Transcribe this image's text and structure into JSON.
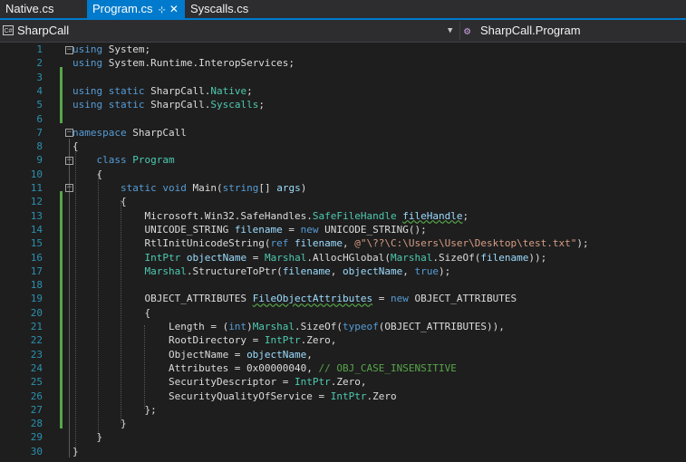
{
  "tabs": [
    {
      "label": "Native.cs",
      "active": false
    },
    {
      "label": "Program.cs",
      "active": true,
      "pin": "⊹",
      "close": "✕"
    },
    {
      "label": "Syscalls.cs",
      "active": false
    }
  ],
  "navbar": {
    "project": "SharpCall",
    "project_icon": "C#",
    "member": "SharpCall.Program"
  },
  "colors": {
    "accent": "#007acc",
    "keyword": "#569cd6",
    "type": "#4ec9b0",
    "string": "#d69d85",
    "comment": "#57a64a"
  },
  "lines": [
    {
      "n": "1",
      "html": "<span class='kw'>using</span> System;"
    },
    {
      "n": "2",
      "html": "<span class='kw'>using</span> System.Runtime.InteropServices;"
    },
    {
      "n": "3",
      "html": ""
    },
    {
      "n": "4",
      "html": "<span class='kw'>using static</span> SharpCall.<span class='ty'>Native</span>;"
    },
    {
      "n": "5",
      "html": "<span class='kw'>using static</span> SharpCall.<span class='ty'>Syscalls</span>;"
    },
    {
      "n": "6",
      "html": ""
    },
    {
      "n": "7",
      "html": "<span class='kw'>namespace</span> SharpCall"
    },
    {
      "n": "8",
      "html": "{"
    },
    {
      "n": "9",
      "html": "    <span class='kw'>class</span> <span class='ty'>Program</span>"
    },
    {
      "n": "10",
      "html": "    {"
    },
    {
      "n": "11",
      "html": "        <span class='kw'>static void</span> Main(<span class='kw'>string</span>[] <span class='id'>args</span>)"
    },
    {
      "n": "12",
      "html": "        {"
    },
    {
      "n": "13",
      "html": "            Microsoft.Win32.SafeHandles.<span class='ty'>SafeFileHandle</span> <span class='id squiggle'>fileHandle</span>;"
    },
    {
      "n": "14",
      "html": "            UNICODE_STRING <span class='id'>filename</span> = <span class='kw'>new</span> UNICODE_STRING();"
    },
    {
      "n": "15",
      "html": "            RtlInitUnicodeString(<span class='kw'>ref</span> <span class='id'>filename</span>, <span class='str'>@\"\\??\\C:\\Users\\User\\Desktop\\test.txt\"</span>);"
    },
    {
      "n": "16",
      "html": "            <span class='ty'>IntPtr</span> <span class='id'>objectName</span> = <span class='ty'>Marshal</span>.AllocHGlobal(<span class='ty'>Marshal</span>.SizeOf(<span class='id'>filename</span>));"
    },
    {
      "n": "17",
      "html": "            <span class='ty'>Marshal</span>.StructureToPtr(<span class='id'>filename</span>, <span class='id'>objectName</span>, <span class='kw'>true</span>);"
    },
    {
      "n": "18",
      "html": ""
    },
    {
      "n": "19",
      "html": "            OBJECT_ATTRIBUTES <span class='id squiggle'>FileObjectAttributes</span> = <span class='kw'>new</span> OBJECT_ATTRIBUTES"
    },
    {
      "n": "20",
      "html": "            {"
    },
    {
      "n": "21",
      "html": "                Length = (<span class='kw'>int</span>)<span class='ty'>Marshal</span>.SizeOf(<span class='kw'>typeof</span>(OBJECT_ATTRIBUTES)),"
    },
    {
      "n": "22",
      "html": "                RootDirectory = <span class='ty'>IntPtr</span>.Zero,"
    },
    {
      "n": "23",
      "html": "                ObjectName = <span class='id'>objectName</span>,"
    },
    {
      "n": "24",
      "html": "                Attributes = 0x00000040, <span class='cm'>// OBJ_CASE_INSENSITIVE</span>"
    },
    {
      "n": "25",
      "html": "                SecurityDescriptor = <span class='ty'>IntPtr</span>.Zero,"
    },
    {
      "n": "26",
      "html": "                SecurityQualityOfService = <span class='ty'>IntPtr</span>.Zero"
    },
    {
      "n": "27",
      "html": "            };"
    },
    {
      "n": "28",
      "html": "        }"
    },
    {
      "n": "29",
      "html": "    }"
    },
    {
      "n": "30",
      "html": "}"
    }
  ]
}
